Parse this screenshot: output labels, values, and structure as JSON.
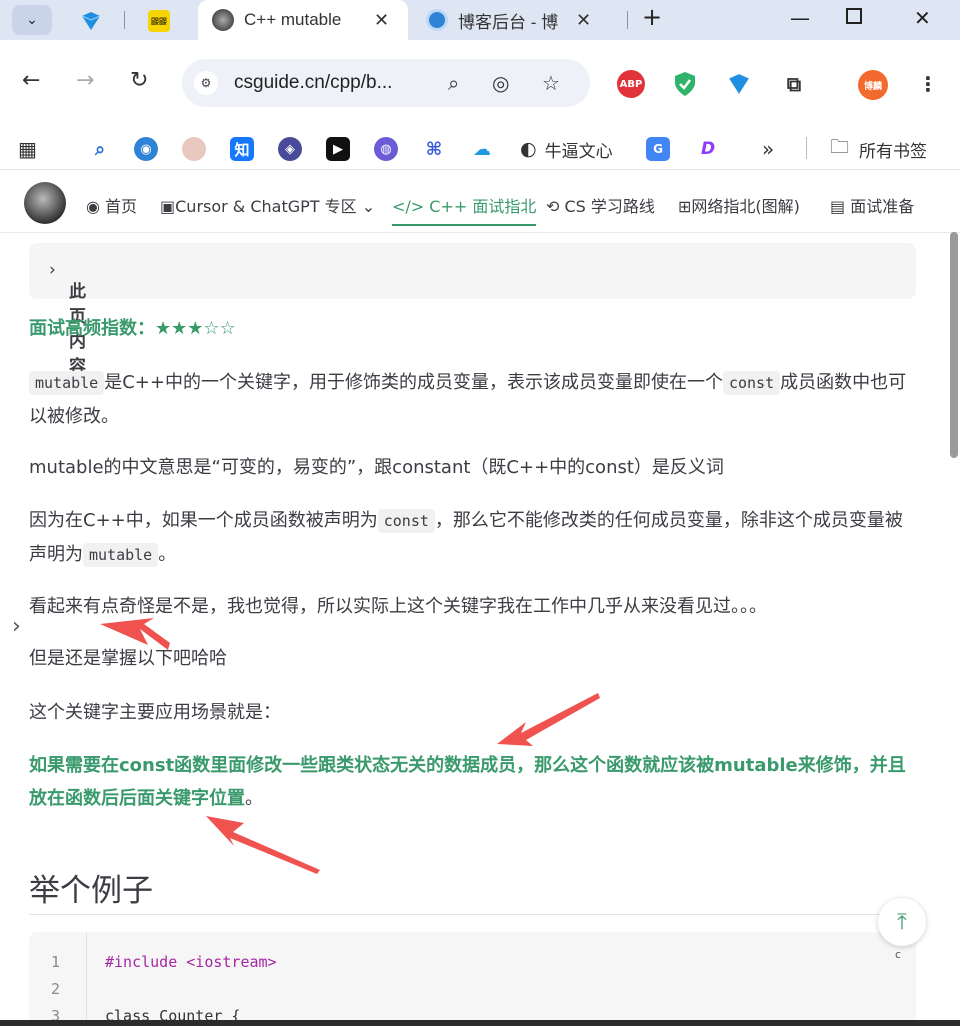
{
  "browser": {
    "active_tab_title": "C++ mutable",
    "tab2_title": "博客后台 - 博",
    "pinned_badge": "鼹鼹",
    "url": "csguide.cn/cpp/b...",
    "bookmarks": [
      {
        "label": "牛逼文心"
      },
      {
        "label": "所有书签"
      }
    ],
    "ext_abp": "ABP",
    "profile": "博麟"
  },
  "site_nav": {
    "items": [
      {
        "label": "首页"
      },
      {
        "label": "Cursor & ChatGPT 专区"
      },
      {
        "label": "C++ 面试指北"
      },
      {
        "label": "CS 学习路线"
      },
      {
        "label": "网络指北(图解)"
      },
      {
        "label": "面试准备"
      }
    ]
  },
  "toc": {
    "title": "此页内容"
  },
  "article": {
    "frequency_label": "面试高频指数：",
    "frequency_stars": "★★★☆☆",
    "p1_code": "mutable",
    "p1_a": "是C++中的一个关键字，用于修饰类的成员变量，表示该成员变量即使在一个",
    "p1_code2": "const",
    "p1_b": "成员函数中也可以被修改。",
    "p2": "mutable的中文意思是“可变的，易变的”，跟constant（既C++中的const）是反义词",
    "p3_a": "因为在C++中，如果一个成员函数被声明为",
    "p3_code": "const",
    "p3_b": "，那么它不能修改类的任何成员变量，除非这个成员变量被声明为",
    "p3_code2": "mutable",
    "p3_c": "。",
    "p4": "看起来有点奇怪是不是，我也觉得，所以实际上这个关键字我在工作中几乎从来没看见过。。。",
    "p5": "但是还是掌握以下吧哈哈",
    "p6": "这个关键字主要应用场景就是：",
    "p7_green": "如果需要在const函数里面修改一些跟类状态无关的数据成员，那么这个函数就应该被mutable来修饰，并且放在函数后后面关键字位置",
    "p7_end": "。",
    "h2": "举个例子"
  },
  "code": {
    "lines": [
      {
        "n": "1",
        "text": "#include <iostream>"
      },
      {
        "n": "2",
        "text": ""
      },
      {
        "n": "3",
        "text": "class Counter {"
      }
    ]
  },
  "colors": {
    "accent": "#3a9a6c",
    "arrow": "#f0524f"
  },
  "misc": {
    "backtop_sub": "c"
  }
}
